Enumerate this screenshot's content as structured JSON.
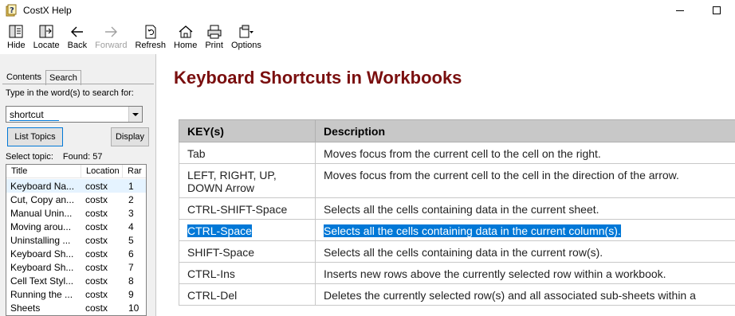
{
  "window": {
    "title": "CostX Help"
  },
  "toolbar": {
    "buttons": [
      {
        "label": "Hide",
        "icon": "hide-icon"
      },
      {
        "label": "Locate",
        "icon": "locate-icon"
      },
      {
        "label": "Back",
        "icon": "back-arrow-icon"
      },
      {
        "label": "Forward",
        "icon": "forward-arrow-icon",
        "disabled": true
      },
      {
        "label": "Refresh",
        "icon": "refresh-icon"
      },
      {
        "label": "Home",
        "icon": "home-icon"
      },
      {
        "label": "Print",
        "icon": "printer-icon"
      },
      {
        "label": "Options",
        "icon": "options-icon"
      }
    ]
  },
  "nav": {
    "tabs": [
      {
        "label": "Contents",
        "active": false
      },
      {
        "label": "Search",
        "active": true
      }
    ],
    "search_label": "Type in the word(s) to search for:",
    "search_value": "shortcut",
    "list_topics_label": "List Topics",
    "display_label": "Display",
    "select_topic_label": "Select topic:",
    "found_label": "Found: 57",
    "columns": [
      "Title",
      "Location",
      "Rar"
    ],
    "results": [
      {
        "title": "Keyboard Na...",
        "location": "costx",
        "rank": "1",
        "selected": true
      },
      {
        "title": "Cut, Copy an...",
        "location": "costx",
        "rank": "2"
      },
      {
        "title": "Manual Unin...",
        "location": "costx",
        "rank": "3"
      },
      {
        "title": "Moving arou...",
        "location": "costx",
        "rank": "4"
      },
      {
        "title": "Uninstalling ...",
        "location": "costx",
        "rank": "5"
      },
      {
        "title": "Keyboard Sh...",
        "location": "costx",
        "rank": "6"
      },
      {
        "title": "Keyboard Sh...",
        "location": "costx",
        "rank": "7"
      },
      {
        "title": "Cell Text Styl...",
        "location": "costx",
        "rank": "8"
      },
      {
        "title": "Running the ...",
        "location": "costx",
        "rank": "9"
      },
      {
        "title": "Sheets",
        "location": "costx",
        "rank": "10"
      }
    ]
  },
  "content": {
    "title": "Keyboard Shortcuts in Workbooks",
    "headers": [
      "KEY(s)",
      "Description"
    ],
    "rows": [
      {
        "key": "Tab",
        "desc": "Moves focus from the current cell to the cell on the right."
      },
      {
        "key": "LEFT, RIGHT, UP, DOWN Arrow",
        "desc": "Moves focus from the current cell to the cell in the direction of the arrow."
      },
      {
        "key": "CTRL-SHIFT-Space",
        "desc": "Selects all the cells containing data in the current sheet."
      },
      {
        "key": "CTRL-Space",
        "desc": "Selects all the cells containing data in the current column(s).",
        "highlighted": true
      },
      {
        "key": "SHIFT-Space",
        "desc": "Selects all the cells containing data in the current row(s)."
      },
      {
        "key": "CTRL-Ins",
        "desc": "Inserts new rows above the currently selected row within a workbook."
      },
      {
        "key": "CTRL-Del",
        "desc": "Deletes the currently selected row(s) and all associated sub-sheets within a"
      }
    ]
  },
  "colors": {
    "title_color": "#7a0f0f",
    "selection": "#0078d7",
    "table_header": "#c8c8c8"
  }
}
